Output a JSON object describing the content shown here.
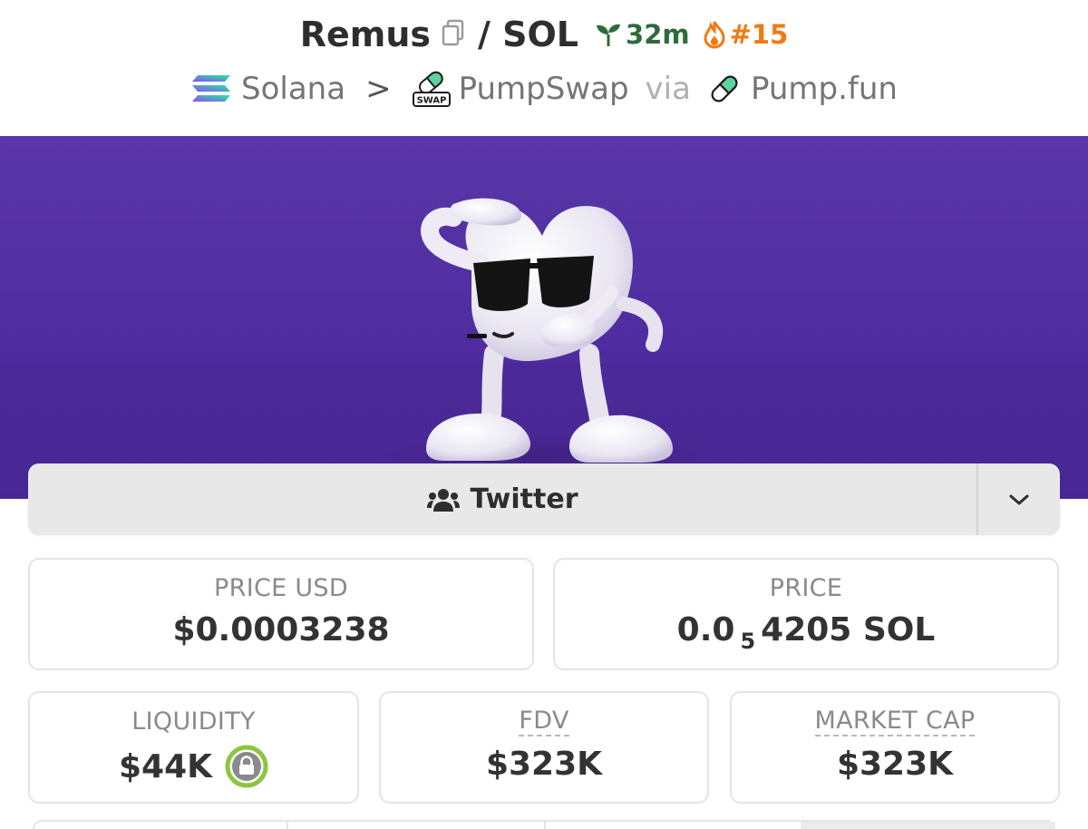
{
  "header": {
    "token_name": "Remus",
    "quote_separator": "/ SOL",
    "age": "32m",
    "rank": "#15",
    "chain": "Solana",
    "breadcrumb_sep": ">",
    "dex": "PumpSwap",
    "via_label": "via",
    "launchpad": "Pump.fun",
    "swap_badge": "SWAP"
  },
  "banner": {
    "image": "mascot-heart-with-sunglasses"
  },
  "social": {
    "label": "Twitter",
    "icon": "users-icon"
  },
  "stats": {
    "price_usd": {
      "label": "PRICE USD",
      "value": "$0.0003238"
    },
    "price": {
      "label": "PRICE",
      "prefix": "0.0",
      "subscript": "5",
      "suffix": "4205 SOL"
    },
    "liquidity": {
      "label": "LIQUIDITY",
      "value": "$44K"
    },
    "fdv": {
      "label": "FDV",
      "value": "$323K"
    },
    "market_cap": {
      "label": "MARKET CAP",
      "value": "$323K"
    }
  },
  "colors": {
    "age_green": "#2f6b3a",
    "rank_orange": "#f07a12",
    "banner_purple": "#5a36a8",
    "lock_green": "#8cc63f"
  }
}
